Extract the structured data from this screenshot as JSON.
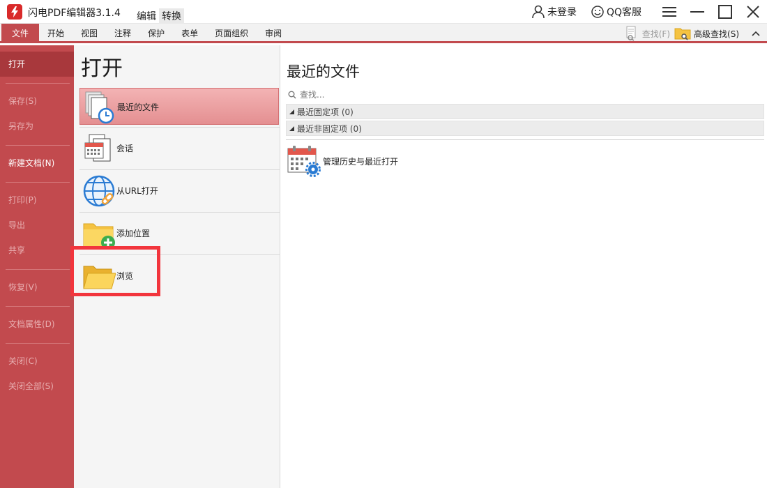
{
  "app": {
    "title": "闪电PDF编辑器3.1.4",
    "mode_tabs": [
      "编辑",
      "转换"
    ],
    "account_label": "未登录",
    "support_label": "QQ客服"
  },
  "menu": {
    "items": [
      "文件",
      "开始",
      "视图",
      "注释",
      "保护",
      "表单",
      "页面组织",
      "审阅"
    ],
    "active_item": "文件",
    "find_label": "查找(F)",
    "advanced_find_label": "高级查找(S)"
  },
  "sidebar": {
    "items": [
      {
        "label": "打开",
        "state": "active"
      },
      {
        "label": "保存(S)",
        "state": "disabled"
      },
      {
        "label": "另存为",
        "state": "disabled"
      },
      {
        "label": "新建文档(N)",
        "state": "enabled"
      },
      {
        "label": "打印(P)",
        "state": "disabled"
      },
      {
        "label": "导出",
        "state": "disabled"
      },
      {
        "label": "共享",
        "state": "disabled"
      },
      {
        "label": "恢复(V)",
        "state": "disabled"
      },
      {
        "label": "文档属性(D)",
        "state": "disabled"
      },
      {
        "label": "关闭(C)",
        "state": "disabled"
      },
      {
        "label": "关闭全部(S)",
        "state": "disabled"
      }
    ]
  },
  "open_panel": {
    "heading": "打开",
    "items": [
      {
        "label": "最近的文件",
        "icon": "recent-files-icon",
        "selected": true
      },
      {
        "label": "会话",
        "icon": "session-calendar-icon",
        "selected": false
      },
      {
        "label": "从URL打开",
        "icon": "globe-link-icon",
        "selected": false
      },
      {
        "label": "添加位置",
        "icon": "folder-add-icon",
        "selected": false
      },
      {
        "label": "浏览",
        "icon": "folder-open-icon",
        "selected": false
      }
    ],
    "highlighted_item": "浏览"
  },
  "recent_panel": {
    "heading": "最近的文件",
    "search_placeholder": "查找...",
    "groups": [
      {
        "label": "最近固定项 (0)"
      },
      {
        "label": "最近非固定项 (0)"
      }
    ],
    "manage_label": "管理历史与最近打开"
  },
  "colors": {
    "accent": "#c24a4e",
    "accent_dark": "#a8383c",
    "highlight": "#f2353d",
    "selected_item": "#e48f91"
  }
}
